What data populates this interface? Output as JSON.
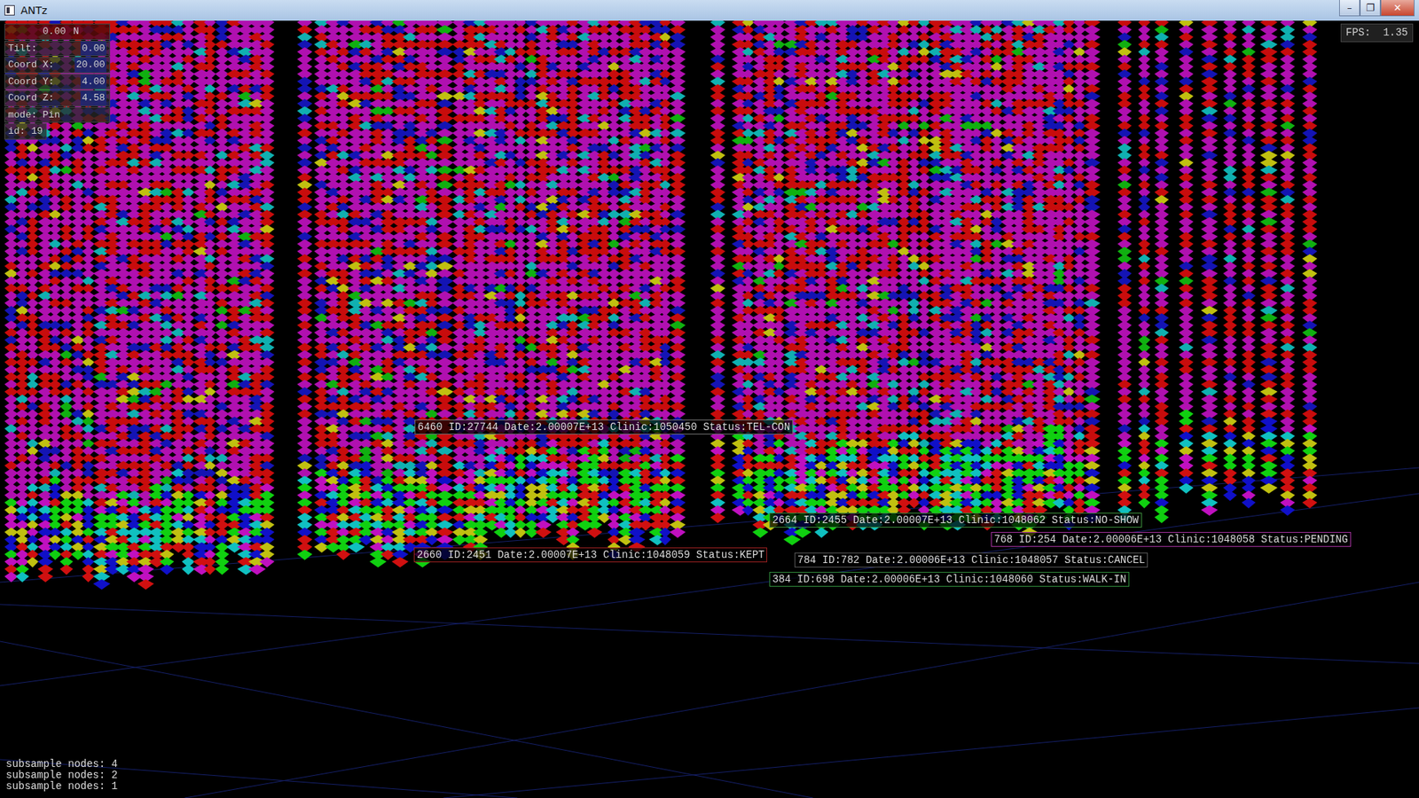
{
  "window": {
    "title": "ANTz",
    "controls": [
      "–",
      "❐",
      "✕"
    ]
  },
  "hud": {
    "heading": {
      "value": "0.00",
      "unit": "N"
    },
    "readouts": [
      {
        "label": "Tilt:",
        "value": "0.00"
      },
      {
        "label": "Coord X:",
        "value": "20.00"
      },
      {
        "label": "Coord Y:",
        "value": "4.00"
      },
      {
        "label": "Coord Z:",
        "value": "4.58"
      }
    ],
    "mode": "mode: Pin",
    "id": "id: 19"
  },
  "fps": "FPS:  1.35",
  "tags": [
    {
      "text": "6460 ID:27744 Date:2.00007E+13 Clinic:1050450 Status:TEL-CON",
      "color": "#6e6e6e"
    },
    {
      "text": "2664 ID:2455 Date:2.00007E+13 Clinic:1048062 Status:NO-SHOW",
      "color": "#3a8a3a"
    },
    {
      "text": "768 ID:254 Date:2.00006E+13 Clinic:1048058 Status:PENDING",
      "color": "#a0309a"
    },
    {
      "text": "2660 ID:2451 Date:2.00007E+13 Clinic:1048059 Status:KEPT",
      "color": "#9a2020"
    },
    {
      "text": "784 ID:782 Date:2.00006E+13 Clinic:1048057 Status:CANCEL",
      "color": "#555555"
    },
    {
      "text": "384 ID:698 Date:2.00006E+13 Clinic:1048060 Status:WALK-IN",
      "color": "#2f8a3a"
    }
  ],
  "log": [
    "subsample nodes: 4",
    "subsample nodes: 2",
    "subsample nodes: 1"
  ]
}
